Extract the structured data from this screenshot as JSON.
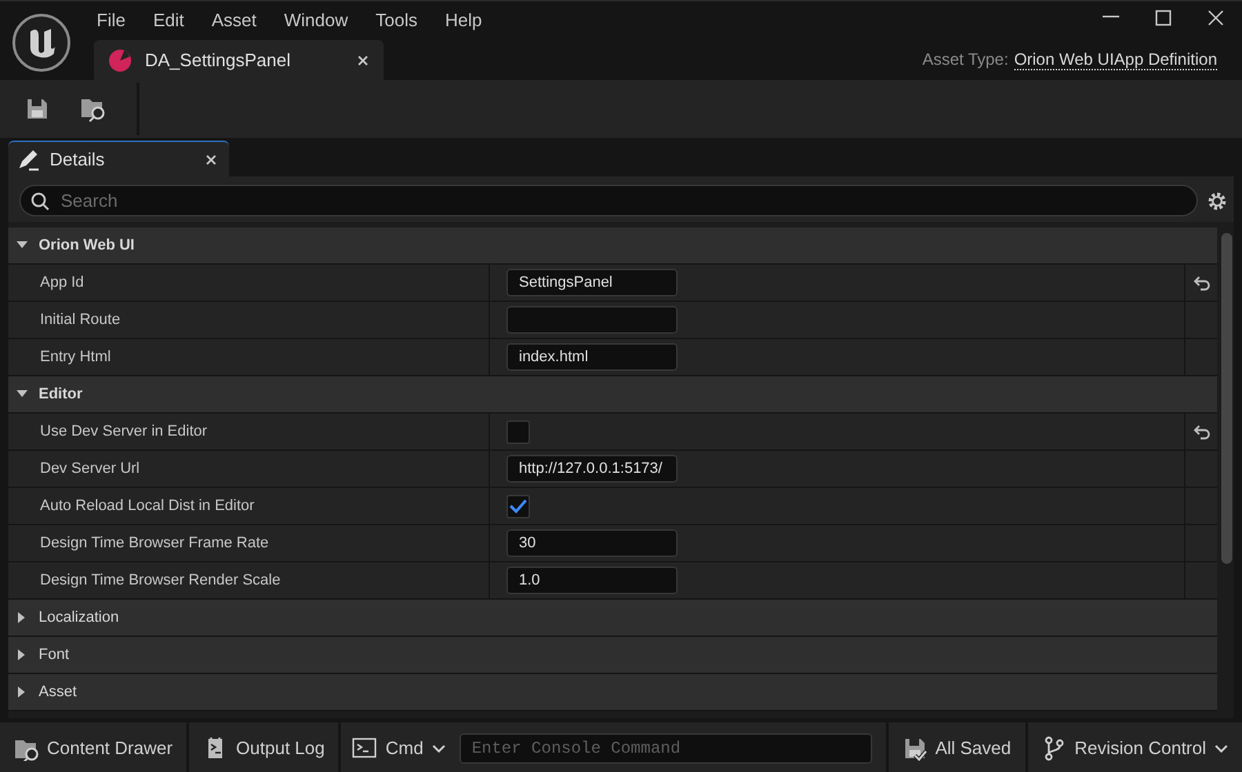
{
  "window": {
    "menu": [
      "File",
      "Edit",
      "Asset",
      "Window",
      "Tools",
      "Help"
    ],
    "tabs": [
      {
        "label": "DA_SettingsPanel",
        "selected": true
      }
    ],
    "asset_type": {
      "label": "Asset Type:",
      "value": "Orion Web UIApp Definition"
    }
  },
  "details": {
    "tab": {
      "label": "Details",
      "selected": true
    },
    "search": {
      "placeholder": "Search"
    },
    "categories": [
      {
        "name": "Orion Web UI",
        "expanded": true,
        "properties": [
          {
            "name": "App Id",
            "kind": "text",
            "value": "SettingsPanel",
            "reset": true
          },
          {
            "name": "Initial Route",
            "kind": "text",
            "reset": false
          },
          {
            "name": "Entry Html",
            "kind": "text",
            "value": "index.html",
            "reset": false
          }
        ]
      },
      {
        "name": "Editor",
        "expanded": true,
        "properties": [
          {
            "name": "Use Dev Server in Editor",
            "kind": "checkbox",
            "checked": false,
            "reset": true
          },
          {
            "name": "Dev Server Url",
            "kind": "text",
            "value": "http://127.0.0.1:5173/",
            "reset": false
          },
          {
            "name": "Auto Reload Local Dist in Editor",
            "kind": "checkbox",
            "checked": true,
            "reset": false
          },
          {
            "name": "Design Time Browser Frame Rate",
            "kind": "text",
            "value": "30",
            "reset": false
          },
          {
            "name": "Design Time Browser Render Scale",
            "kind": "text",
            "value": "1.0",
            "reset": false
          }
        ]
      },
      {
        "name": "Localization",
        "expanded": false
      },
      {
        "name": "Font",
        "expanded": false
      },
      {
        "name": "Asset",
        "expanded": false
      }
    ]
  },
  "status_bar": {
    "content_drawer": "Content Drawer",
    "output_log": "Output Log",
    "cmd": "Cmd",
    "console": {
      "placeholder": "Enter Console Command"
    },
    "save_state": "All Saved",
    "revision_control": "Revision Control"
  }
}
